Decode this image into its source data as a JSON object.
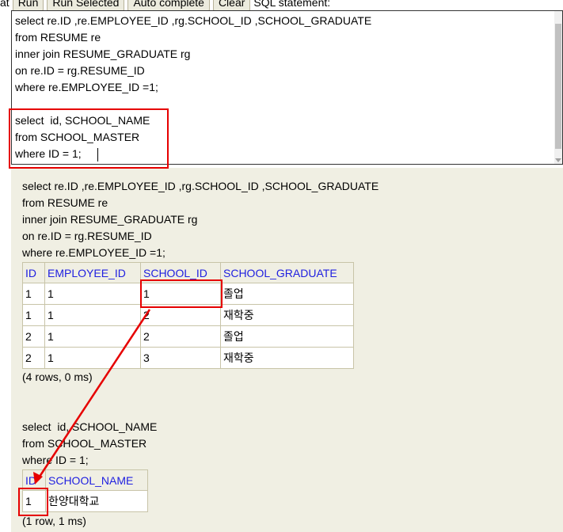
{
  "toolbar": {
    "leading_text": "at",
    "buttons": [
      "Run",
      "Run Selected",
      "Auto complete",
      "Clear"
    ],
    "trailing_text": "SQL statement:"
  },
  "editor": {
    "sql": "select re.ID ,re.EMPLOYEE_ID ,rg.SCHOOL_ID ,SCHOOL_GRADUATE\nfrom RESUME re\ninner join RESUME_GRADUATE rg\non re.ID = rg.RESUME_ID\nwhere re.EMPLOYEE_ID =1;\n\nselect  id, SCHOOL_NAME\nfrom SCHOOL_MASTER\nwhere ID = 1;"
  },
  "results": [
    {
      "query": "select re.ID ,re.EMPLOYEE_ID ,rg.SCHOOL_ID ,SCHOOL_GRADUATE\nfrom RESUME re\ninner join RESUME_GRADUATE rg\non re.ID = rg.RESUME_ID\nwhere re.EMPLOYEE_ID =1;",
      "columns": [
        "ID",
        "EMPLOYEE_ID",
        "SCHOOL_ID",
        "SCHOOL_GRADUATE"
      ],
      "rows": [
        [
          "1",
          "1",
          "1",
          "졸업"
        ],
        [
          "1",
          "1",
          "2",
          "재학중"
        ],
        [
          "2",
          "1",
          "2",
          "졸업"
        ],
        [
          "2",
          "1",
          "3",
          "재학중"
        ]
      ],
      "info": "(4 rows, 0 ms)"
    },
    {
      "query": "select  id, SCHOOL_NAME\nfrom SCHOOL_MASTER\nwhere ID = 1;",
      "columns": [
        "ID",
        "SCHOOL_NAME"
      ],
      "rows": [
        [
          "1",
          "한양대학교"
        ]
      ],
      "info": "(1 row, 1 ms)"
    }
  ],
  "colors": {
    "header_link": "#2020e0",
    "results_background": "#f0efe3",
    "annotation": "#e60000"
  }
}
